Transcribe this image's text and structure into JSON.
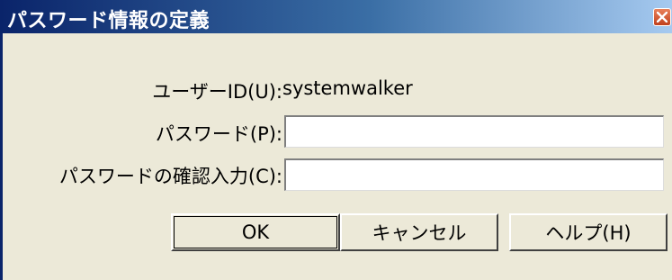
{
  "window": {
    "title": "パスワード情報の定義"
  },
  "form": {
    "userid_label": "ユーザーID(U):",
    "userid_value": "systemwalker",
    "password_label": "パスワード(P):",
    "password_value": "",
    "confirm_label": "パスワードの確認入力(C):",
    "confirm_value": ""
  },
  "buttons": {
    "ok_label": "OK",
    "cancel_label": "キャンセル",
    "help_label": "ヘルプ(H)"
  },
  "icons": {
    "close": "close-icon"
  },
  "colors": {
    "titlebar_start": "#0a246a",
    "titlebar_end": "#a6caf0",
    "dialog_bg": "#ece9d8",
    "close_button": "#c0401c"
  }
}
